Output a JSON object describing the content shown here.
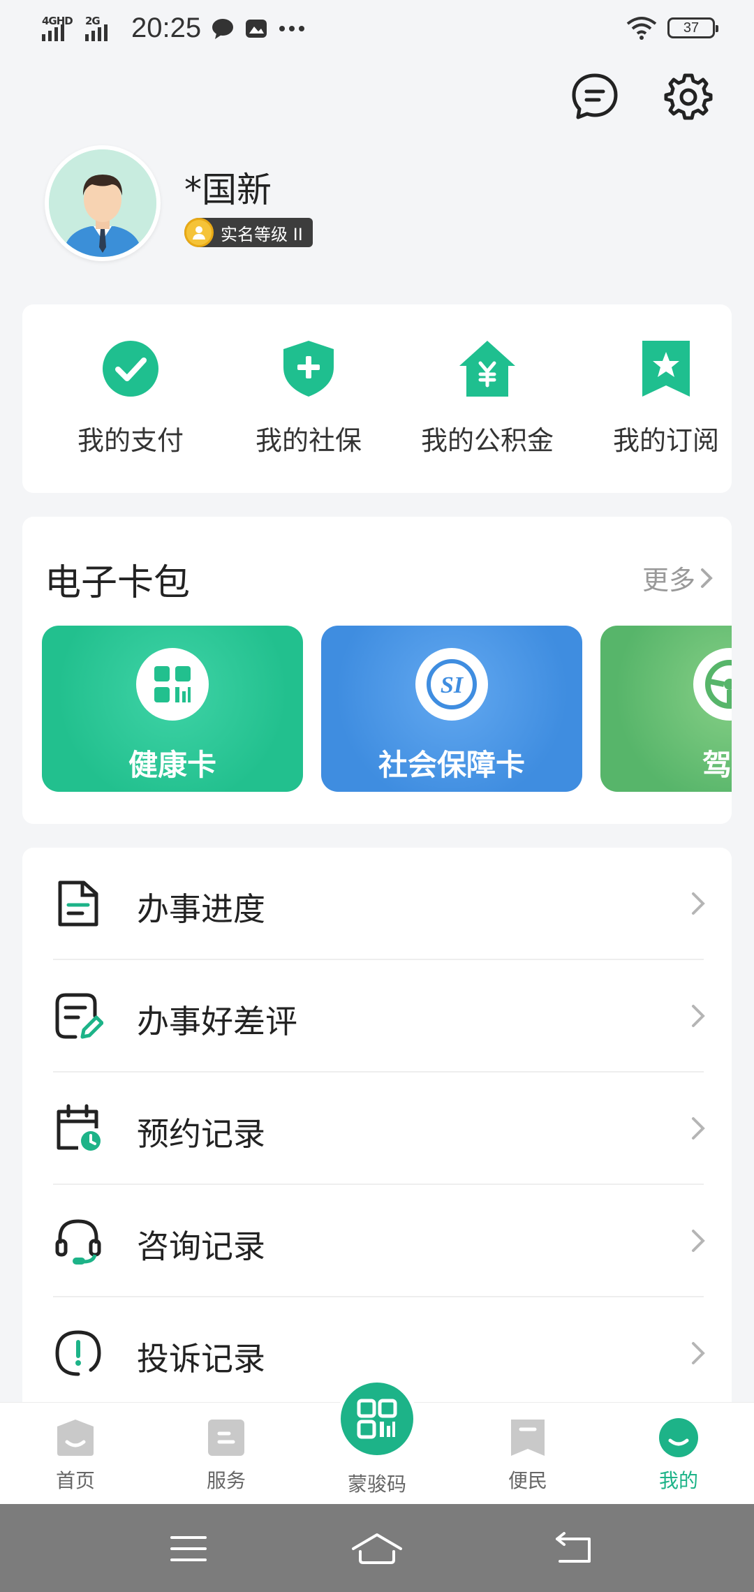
{
  "status_bar": {
    "network_1": "4GHD",
    "network_2": "2G",
    "time": "20:25",
    "battery": "37"
  },
  "profile": {
    "name": "*国新",
    "level": "实名等级 II"
  },
  "quick_actions": [
    {
      "label": "我的支付",
      "icon": "check-circle-icon"
    },
    {
      "label": "我的社保",
      "icon": "shield-plus-icon"
    },
    {
      "label": "我的公积金",
      "icon": "house-yen-icon"
    },
    {
      "label": "我的订阅",
      "icon": "bookmark-star-icon"
    }
  ],
  "wallet": {
    "title": "电子卡包",
    "more": "更多",
    "cards": [
      {
        "label": "健康卡",
        "icon": "health-card-icon",
        "color": "#22c08e"
      },
      {
        "label": "社会保障卡",
        "icon": "social-security-icon",
        "color": "#3f8de0"
      },
      {
        "label": "驾驶",
        "icon": "steering-wheel-icon",
        "color": "#57b56a"
      }
    ]
  },
  "menu": [
    {
      "label": "办事进度",
      "icon": "document-icon"
    },
    {
      "label": "办事好差评",
      "icon": "review-edit-icon"
    },
    {
      "label": "预约记录",
      "icon": "calendar-clock-icon"
    },
    {
      "label": "咨询记录",
      "icon": "headset-icon"
    },
    {
      "label": "投诉记录",
      "icon": "alert-circle-icon"
    }
  ],
  "tabbar": {
    "home": "首页",
    "service": "服务",
    "qr": "蒙骏码",
    "convenience": "便民",
    "mine": "我的"
  },
  "colors": {
    "accent": "#1db388",
    "health_card": "#22c08e",
    "social_card": "#3f8de0",
    "drive_card": "#57b56a"
  }
}
